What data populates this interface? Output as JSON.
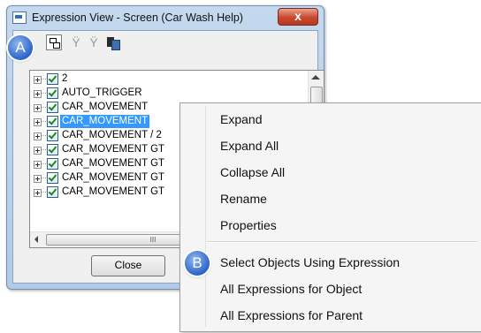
{
  "window": {
    "title": "Expression View - Screen (Car Wash Help)",
    "close_glyph": "x"
  },
  "toolbar": {
    "icons": [
      "expression-view-icon",
      "filter-icon",
      "filter-alt-icon",
      "copy-icon"
    ],
    "filter_glyph": "Ÿ"
  },
  "badges": {
    "a": "A",
    "b": "B"
  },
  "tree": {
    "items": [
      {
        "label": "2",
        "checked": true,
        "selected": false
      },
      {
        "label": "AUTO_TRIGGER",
        "checked": true,
        "selected": false
      },
      {
        "label": "CAR_MOVEMENT",
        "checked": true,
        "selected": false
      },
      {
        "label": "CAR_MOVEMENT",
        "checked": true,
        "selected": true
      },
      {
        "label": "CAR_MOVEMENT / 2",
        "checked": true,
        "selected": false
      },
      {
        "label": "CAR_MOVEMENT GT",
        "checked": true,
        "selected": false
      },
      {
        "label": "CAR_MOVEMENT GT",
        "checked": true,
        "selected": false
      },
      {
        "label": "CAR_MOVEMENT GT",
        "checked": true,
        "selected": false
      },
      {
        "label": "CAR_MOVEMENT GT",
        "checked": true,
        "selected": false
      }
    ],
    "hscroll_grip": "III"
  },
  "buttons": {
    "close": "Close"
  },
  "context_menu": {
    "items": [
      {
        "label": "Expand"
      },
      {
        "label": "Expand All"
      },
      {
        "label": "Collapse All"
      },
      {
        "label": "Rename"
      },
      {
        "label": "Properties"
      },
      {
        "label": "Select Objects Using Expression"
      },
      {
        "label": "All Expressions for Object"
      },
      {
        "label": "All Expressions for Parent"
      }
    ]
  }
}
